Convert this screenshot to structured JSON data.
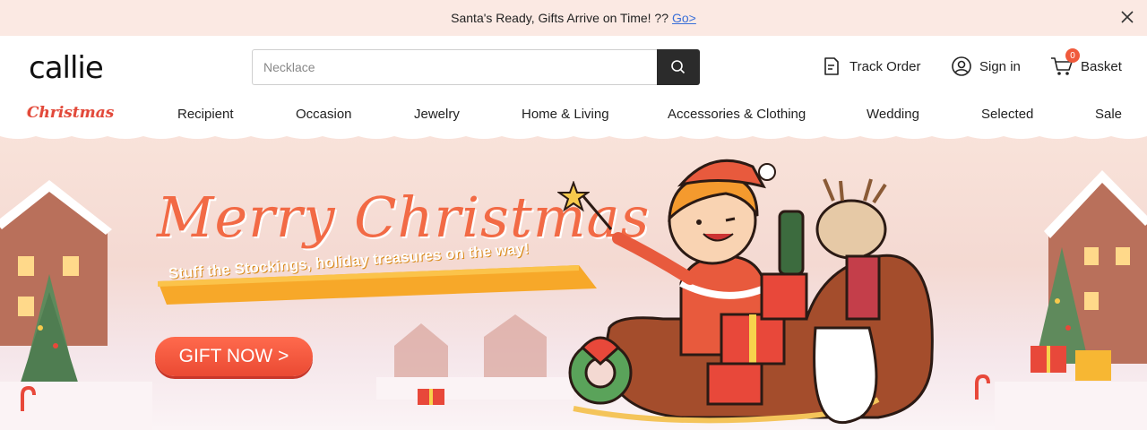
{
  "announcement": {
    "text": "Santa's Ready, Gifts Arrive on Time! ?? ",
    "link": "Go>"
  },
  "header": {
    "logo": "callie",
    "search_placeholder": "Necklace",
    "track_order": "Track Order",
    "sign_in": "Sign in",
    "basket": "Basket",
    "basket_count": "0"
  },
  "nav": {
    "christmas": "Christmas",
    "items": [
      "Recipient",
      "Occasion",
      "Jewelry",
      "Home & Living",
      "Accessories & Clothing",
      "Wedding",
      "Selected",
      "Sale"
    ]
  },
  "hero": {
    "headline": "Merry Christmas",
    "tagline": "Stuff the Stockings, holiday treasures on the way!",
    "cta": "GIFT NOW >"
  },
  "colors": {
    "announce_bg": "#fbe9e3",
    "accent": "#ea4a33",
    "search_button": "#2b2b2b",
    "link": "#3a6fd8"
  },
  "icons": [
    "close-icon",
    "search-icon",
    "track-order-icon",
    "user-icon",
    "cart-icon",
    "star-wand-icon"
  ]
}
